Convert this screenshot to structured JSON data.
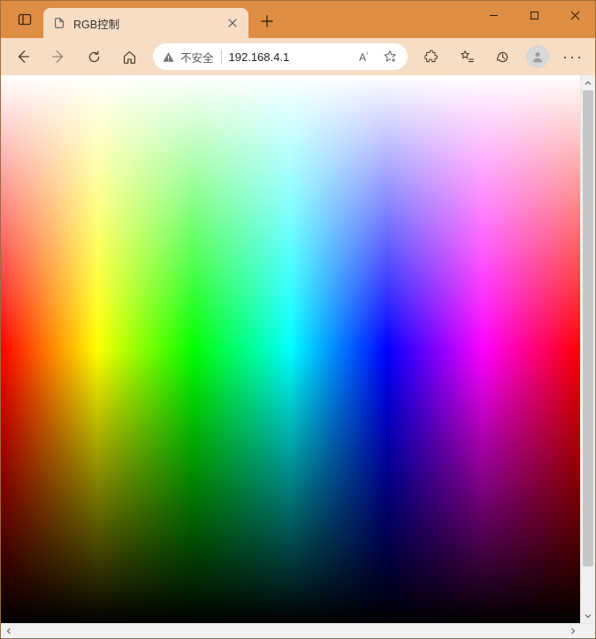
{
  "window": {
    "minimize_tooltip": "Minimize",
    "maximize_tooltip": "Maximize",
    "close_tooltip": "Close"
  },
  "tabs": {
    "active": {
      "title": "RGB控制"
    },
    "newtab_tooltip": "New tab"
  },
  "toolbar": {
    "back_tooltip": "Back",
    "forward_tooltip": "Forward",
    "refresh_tooltip": "Refresh",
    "home_tooltip": "Home"
  },
  "omnibox": {
    "security_label": "不安全",
    "url": "192.168.4.1",
    "read_aloud_tooltip": "Read aloud",
    "favorite_tooltip": "Add to favorites"
  },
  "actions": {
    "extensions_tooltip": "Extensions",
    "favorites_tooltip": "Favorites",
    "history_tooltip": "History",
    "profile_tooltip": "Profile",
    "more_tooltip": "Settings and more"
  },
  "page": {
    "description": "RGB color picker field"
  }
}
